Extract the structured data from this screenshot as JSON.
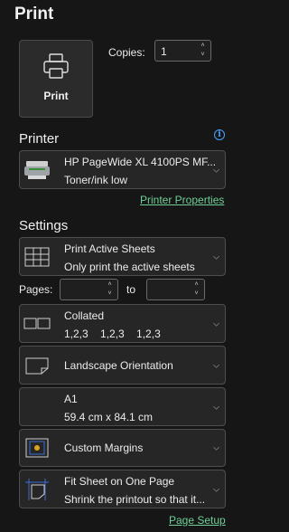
{
  "header": {
    "title": "Print"
  },
  "print_button": {
    "label": "Print"
  },
  "copies": {
    "label": "Copies:",
    "value": "1"
  },
  "printer": {
    "section_title": "Printer",
    "info_icon_text": "i",
    "name": "HP PageWide XL 4100PS MF...",
    "status": "Toner/ink low",
    "properties_link": "Printer Properties"
  },
  "settings": {
    "section_title": "Settings",
    "what_to_print": {
      "title": "Print Active Sheets",
      "subtitle": "Only print the active sheets"
    },
    "pages": {
      "label": "Pages:",
      "from": "",
      "to_label": "to",
      "to": ""
    },
    "collation": {
      "title": "Collated",
      "subtitle": "1,2,3    1,2,3    1,2,3"
    },
    "orientation": {
      "title": "Landscape Orientation"
    },
    "paper": {
      "title": "A1",
      "subtitle": "59.4 cm x 84.1 cm"
    },
    "margins": {
      "title": "Custom Margins"
    },
    "scaling": {
      "title": "Fit Sheet on One Page",
      "subtitle": "Shrink the printout so that it..."
    },
    "page_setup_link": "Page Setup"
  },
  "colors": {
    "background": "#161616",
    "control": "#262626",
    "border": "#4e4e4e",
    "link": "#6fcf97",
    "accent": "#4aa3ff",
    "margin_icon": "#3b6fd6"
  },
  "icons": [
    "printer-icon",
    "chevron-down-icon",
    "up-arrow-icon",
    "down-arrow-icon",
    "info-icon",
    "printer-device-icon",
    "sheets-grid-icon",
    "collated-icon",
    "landscape-page-icon",
    "custom-margins-icon",
    "fit-sheet-icon"
  ]
}
